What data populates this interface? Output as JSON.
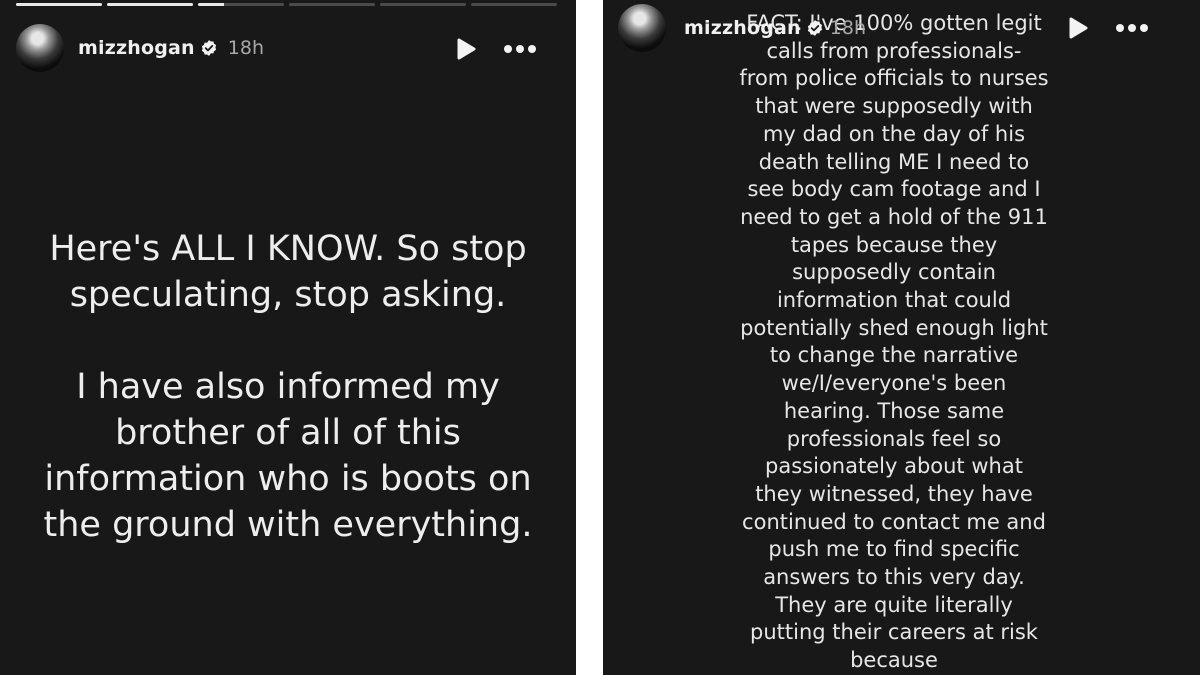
{
  "left_story": {
    "username": "mizzhogan",
    "timestamp": "18h",
    "progress": [
      1,
      1,
      0.3,
      0,
      0,
      0
    ],
    "paragraphs": [
      "Here's ALL I KNOW. So stop speculating, stop asking.",
      "I have also informed my brother of all of this information who is boots on the ground with everything."
    ]
  },
  "right_story": {
    "username": "mizzhogan",
    "timestamp": "18h",
    "text": "FACT: I've 100% gotten legit calls from professionals- from police officials to nurses that were supposedly with my dad on the day of his death telling ME I need to see body cam footage and I need to get a hold of the 911 tapes because they supposedly contain information that could potentially shed enough light to change the narrative we/I/everyone's been hearing. Those same professionals feel so passionately about what they witnessed, they have continued to contact me and push me to find specific answers to this very day. They are quite literally putting their careers at risk because"
  },
  "icons": {
    "verified": "verified-badge-icon",
    "play": "play-icon",
    "more": "more-options-icon"
  },
  "colors": {
    "background": "#181818",
    "text": "#ededed",
    "muted": "#a8a8a8"
  }
}
